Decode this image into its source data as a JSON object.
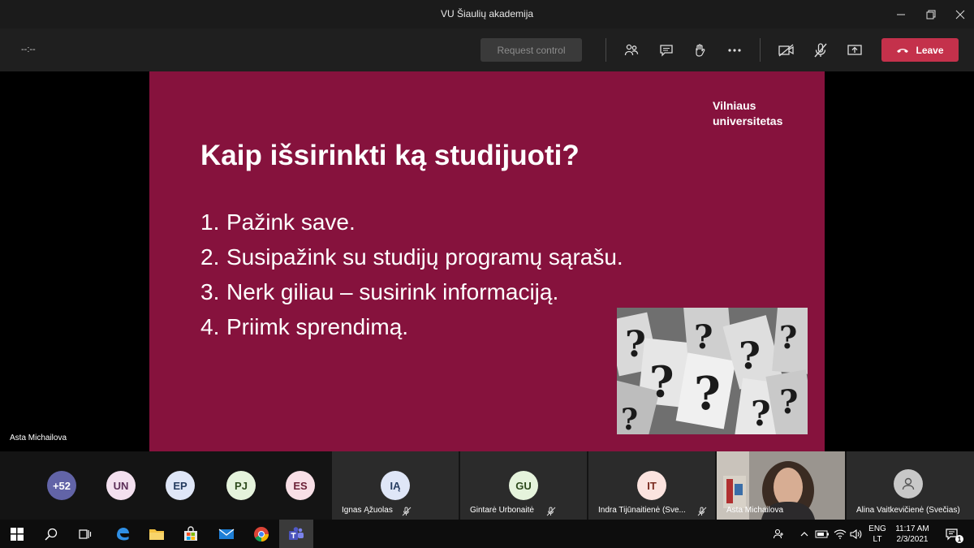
{
  "window": {
    "title": "VU Šiaulių akademija"
  },
  "toolbar": {
    "timer": "--:--",
    "request_control": "Request control",
    "leave": "Leave"
  },
  "slide": {
    "logo_line1": "Vilniaus",
    "logo_line2": "universitetas",
    "heading": "Kaip išsirinkti ką studijuoti?",
    "items": [
      {
        "num": "1.",
        "text": "Pažink save."
      },
      {
        "num": "2.",
        "text": "Susipažink su studijų programų sąrašu."
      },
      {
        "num": "3.",
        "text": "Nerk giliau – susirink informaciją."
      },
      {
        "num": "4.",
        "text": "Priimk sprendimą."
      }
    ],
    "presenter_label": "Asta Michailova"
  },
  "participants": {
    "avatars": [
      {
        "initials": "+52",
        "bg": "#6264a7",
        "fg": "#ffffff"
      },
      {
        "initials": "UN",
        "bg": "#f3e0ef",
        "fg": "#5c2e58"
      },
      {
        "initials": "EP",
        "bg": "#dfe6f7",
        "fg": "#243a5e"
      },
      {
        "initials": "PJ",
        "bg": "#e5f3dc",
        "fg": "#2d4a1c"
      },
      {
        "initials": "ES",
        "bg": "#f8dfe6",
        "fg": "#6b2037"
      }
    ],
    "tiles": [
      {
        "initials": "IĄ",
        "name": "Ignas Ąžuolas",
        "bg": "#dfe6f7",
        "fg": "#243a5e"
      },
      {
        "initials": "GU",
        "name": "Gintarė Urbonaitė",
        "bg": "#e5f3dc",
        "fg": "#2d4a1c"
      },
      {
        "initials": "IT",
        "name": "Indra Tijūnaitienė (Sve...",
        "bg": "#fbe3df",
        "fg": "#7a2a1f"
      },
      {
        "name": "Asta Michailova"
      },
      {
        "name": "Alina Vaitkevičienė (Svečias)"
      }
    ]
  },
  "taskbar": {
    "lang_top": "ENG",
    "lang_bottom": "LT",
    "time": "11:17 AM",
    "date": "2/3/2021",
    "notifications": "1"
  },
  "colors": {
    "slide_bg": "#86123d",
    "leave_red": "#c4314b",
    "toolbar_bg": "#1f1f1f"
  }
}
